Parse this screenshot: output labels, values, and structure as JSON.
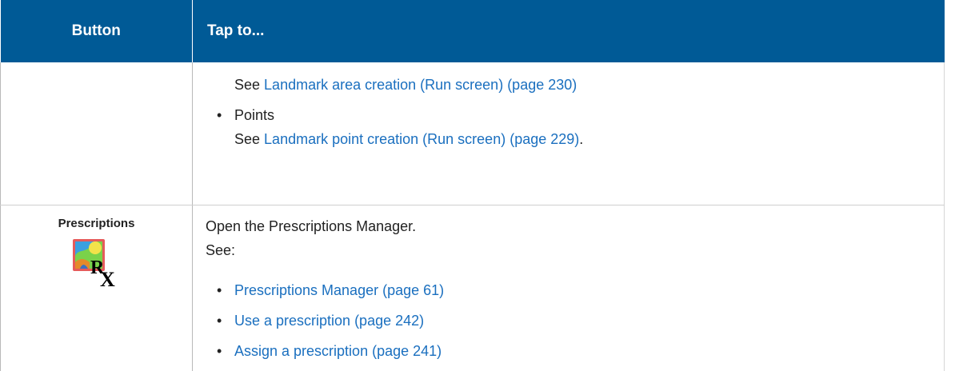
{
  "header": {
    "col_button": "Button",
    "col_tap": "Tap to..."
  },
  "row_landmark": {
    "see_prefix_1": "See",
    "link_area": "Landmark area creation (Run screen) (page 230)",
    "bullet_points": "Points",
    "see_prefix_2": "See",
    "link_point": "Landmark point creation (Run screen) (page 229)",
    "trailing_period": "."
  },
  "row_prescriptions": {
    "button_title": "Prescriptions",
    "icon": "prescription-rx-icon",
    "description": "Open the Prescriptions Manager.",
    "see_label": "See:",
    "links": [
      "Prescriptions Manager (page 61)",
      "Use a prescription (page 242)",
      "Assign a prescription (page 241)"
    ]
  },
  "colors": {
    "header_bg": "#005a96",
    "link": "#1a6fbf",
    "text": "#222222"
  }
}
